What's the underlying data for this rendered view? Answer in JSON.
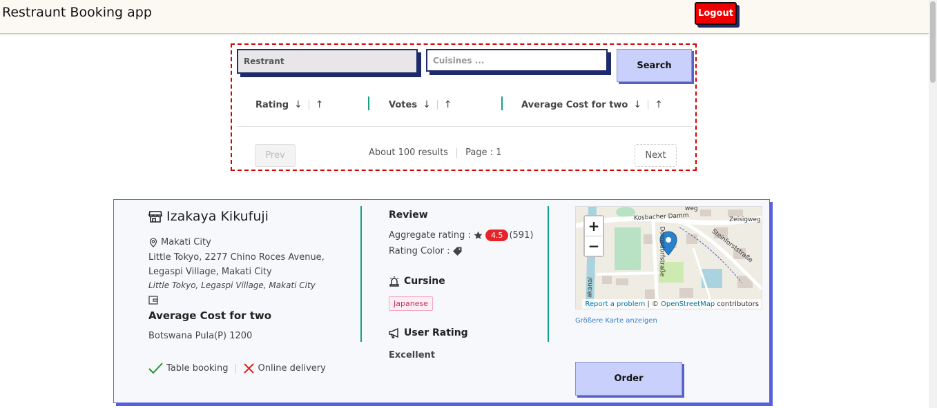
{
  "header": {
    "title": "Restraunt Booking app",
    "logout_label": "Logout"
  },
  "search": {
    "restaurant_value": "Restrant",
    "cuisines_placeholder": "Cuisines ...",
    "search_label": "Search"
  },
  "sort": {
    "rating_label": "Rating",
    "votes_label": "Votes",
    "cost_label": "Average Cost for two",
    "down_arrow": "↓",
    "up_arrow": "↑"
  },
  "pagination": {
    "prev_label": "Prev",
    "next_label": "Next",
    "results_text": "About 100 results",
    "page_text": "Page : 1"
  },
  "restaurant": {
    "name": "Izakaya Kikufuji",
    "city": "Makati City",
    "address": "Little Tokyo, 2277 Chino Roces Avenue, Legaspi Village, Makati City",
    "locality": "Little Tokyo, Legaspi Village, Makati City",
    "cost_title": "Average Cost for two",
    "cost_value": "Botswana Pula(P) 1200",
    "table_booking_label": "Table booking",
    "online_delivery_label": "Online delivery",
    "review_title": "Review",
    "aggregate_label": "Aggregate rating :",
    "aggregate_rating": "4.5",
    "votes": "(591)",
    "rating_color_label": "Rating Color :",
    "cuisine_title": "Cursine",
    "cuisine_tag": "Japanese",
    "user_rating_title": "User Rating",
    "user_rating_value": "Excellent",
    "order_label": "Order",
    "accent_green": "#14a085",
    "badge_red": "#e4262a"
  },
  "map": {
    "zoom_in": "+",
    "zoom_out": "−",
    "report_problem": "Report a problem",
    "attribution_sep": "| ©",
    "osm_link": "OpenStreetMap",
    "contributors": "contributors",
    "bigger_map": "Größere Karte anzeigen",
    "streets": [
      "Kosbacher Damm",
      "Zeisigweg",
      "Steinforststraße",
      "Dornsdorfstraße",
      "akanal",
      "weg"
    ]
  }
}
